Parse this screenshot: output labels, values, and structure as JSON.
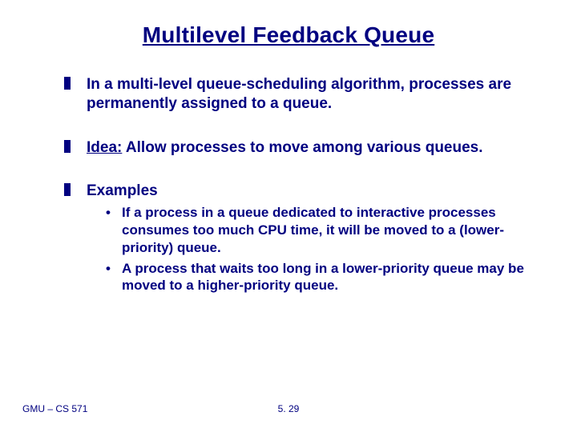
{
  "title": "Multilevel Feedback Queue",
  "bullets": {
    "b1": "In a multi-level queue-scheduling algorithm, processes are permanently assigned to a queue.",
    "b2_idea": "Idea:",
    "b2_rest": " Allow processes to move among  various queues.",
    "b3": "Examples",
    "b3_sub1": "If a process in a queue dedicated to interactive processes consumes too much CPU time, it will be moved to a (lower-priority) queue.",
    "b3_sub2": "A process that waits too long in a lower-priority queue may be moved to a higher-priority queue."
  },
  "footer": {
    "left": "GMU – CS 571",
    "center": "5. 29"
  }
}
